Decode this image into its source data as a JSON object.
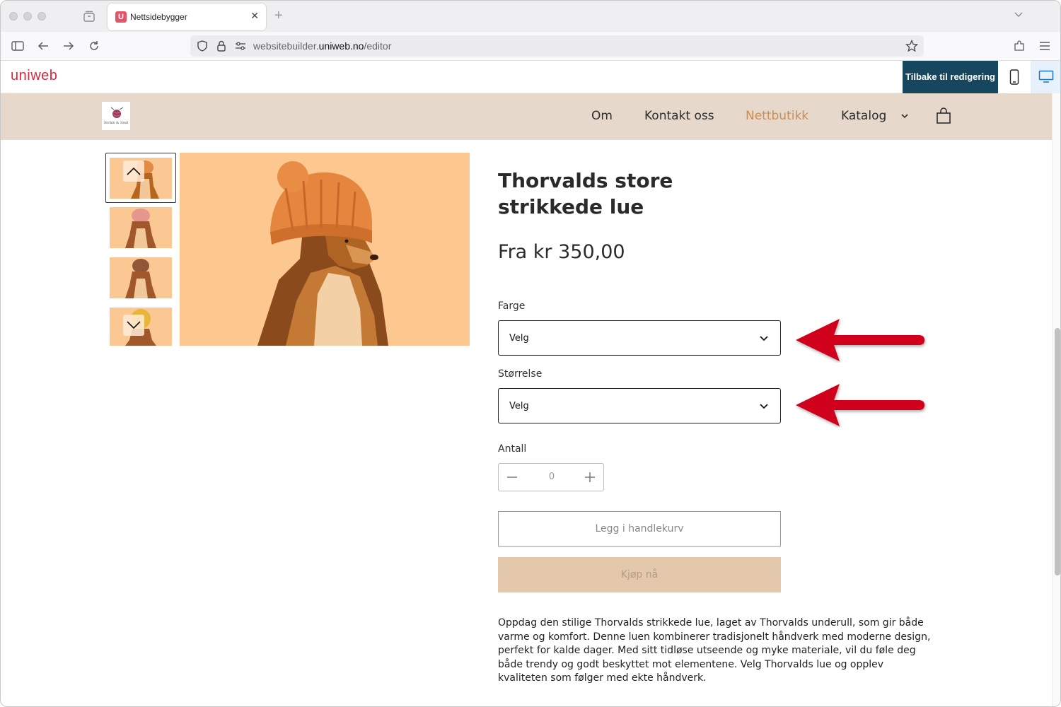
{
  "browser": {
    "tab_title": "Nettsidebygger",
    "favicon_letter": "U",
    "url_prefix": "websitebuilder.",
    "url_domain": "uniweb.no",
    "url_path": "/editor"
  },
  "editor": {
    "logo": "uniweb",
    "back_button": "Tilbake til redigering",
    "accent": "#16475e"
  },
  "site": {
    "logo_text": "Strikk & Smil",
    "menu": [
      {
        "label": "Om"
      },
      {
        "label": "Kontakt oss"
      },
      {
        "label": "Nettbutikk",
        "active": true
      },
      {
        "label": "Katalog"
      }
    ],
    "header_bg": "#e6d8ca",
    "active_color": "#c98d55"
  },
  "product": {
    "title": "Thorvalds store strikkede lue",
    "price": "Fra kr 350,00",
    "color_label": "Farge",
    "color_value": "Velg",
    "size_label": "Størrelse",
    "size_value": "Velg",
    "qty_label": "Antall",
    "qty_value": "0",
    "add_to_cart": "Legg i handlekurv",
    "buy_now": "Kjøp nå",
    "description": "Oppdag den stilige Thorvalds strikkede lue, laget av Thorvalds underull, som gir både varme og komfort. Denne luen kombinerer tradisjonelt håndverk med moderne design, perfekt for kalde dager. Med sitt tidløse utseende og myke materiale, vil du føle deg både trendy og godt beskyttet mot elementene. Velg Thorvalds lue og opplev kvaliteten som følger med ekte håndverk."
  },
  "annotations": {
    "arrow_color": "#d0021b"
  }
}
